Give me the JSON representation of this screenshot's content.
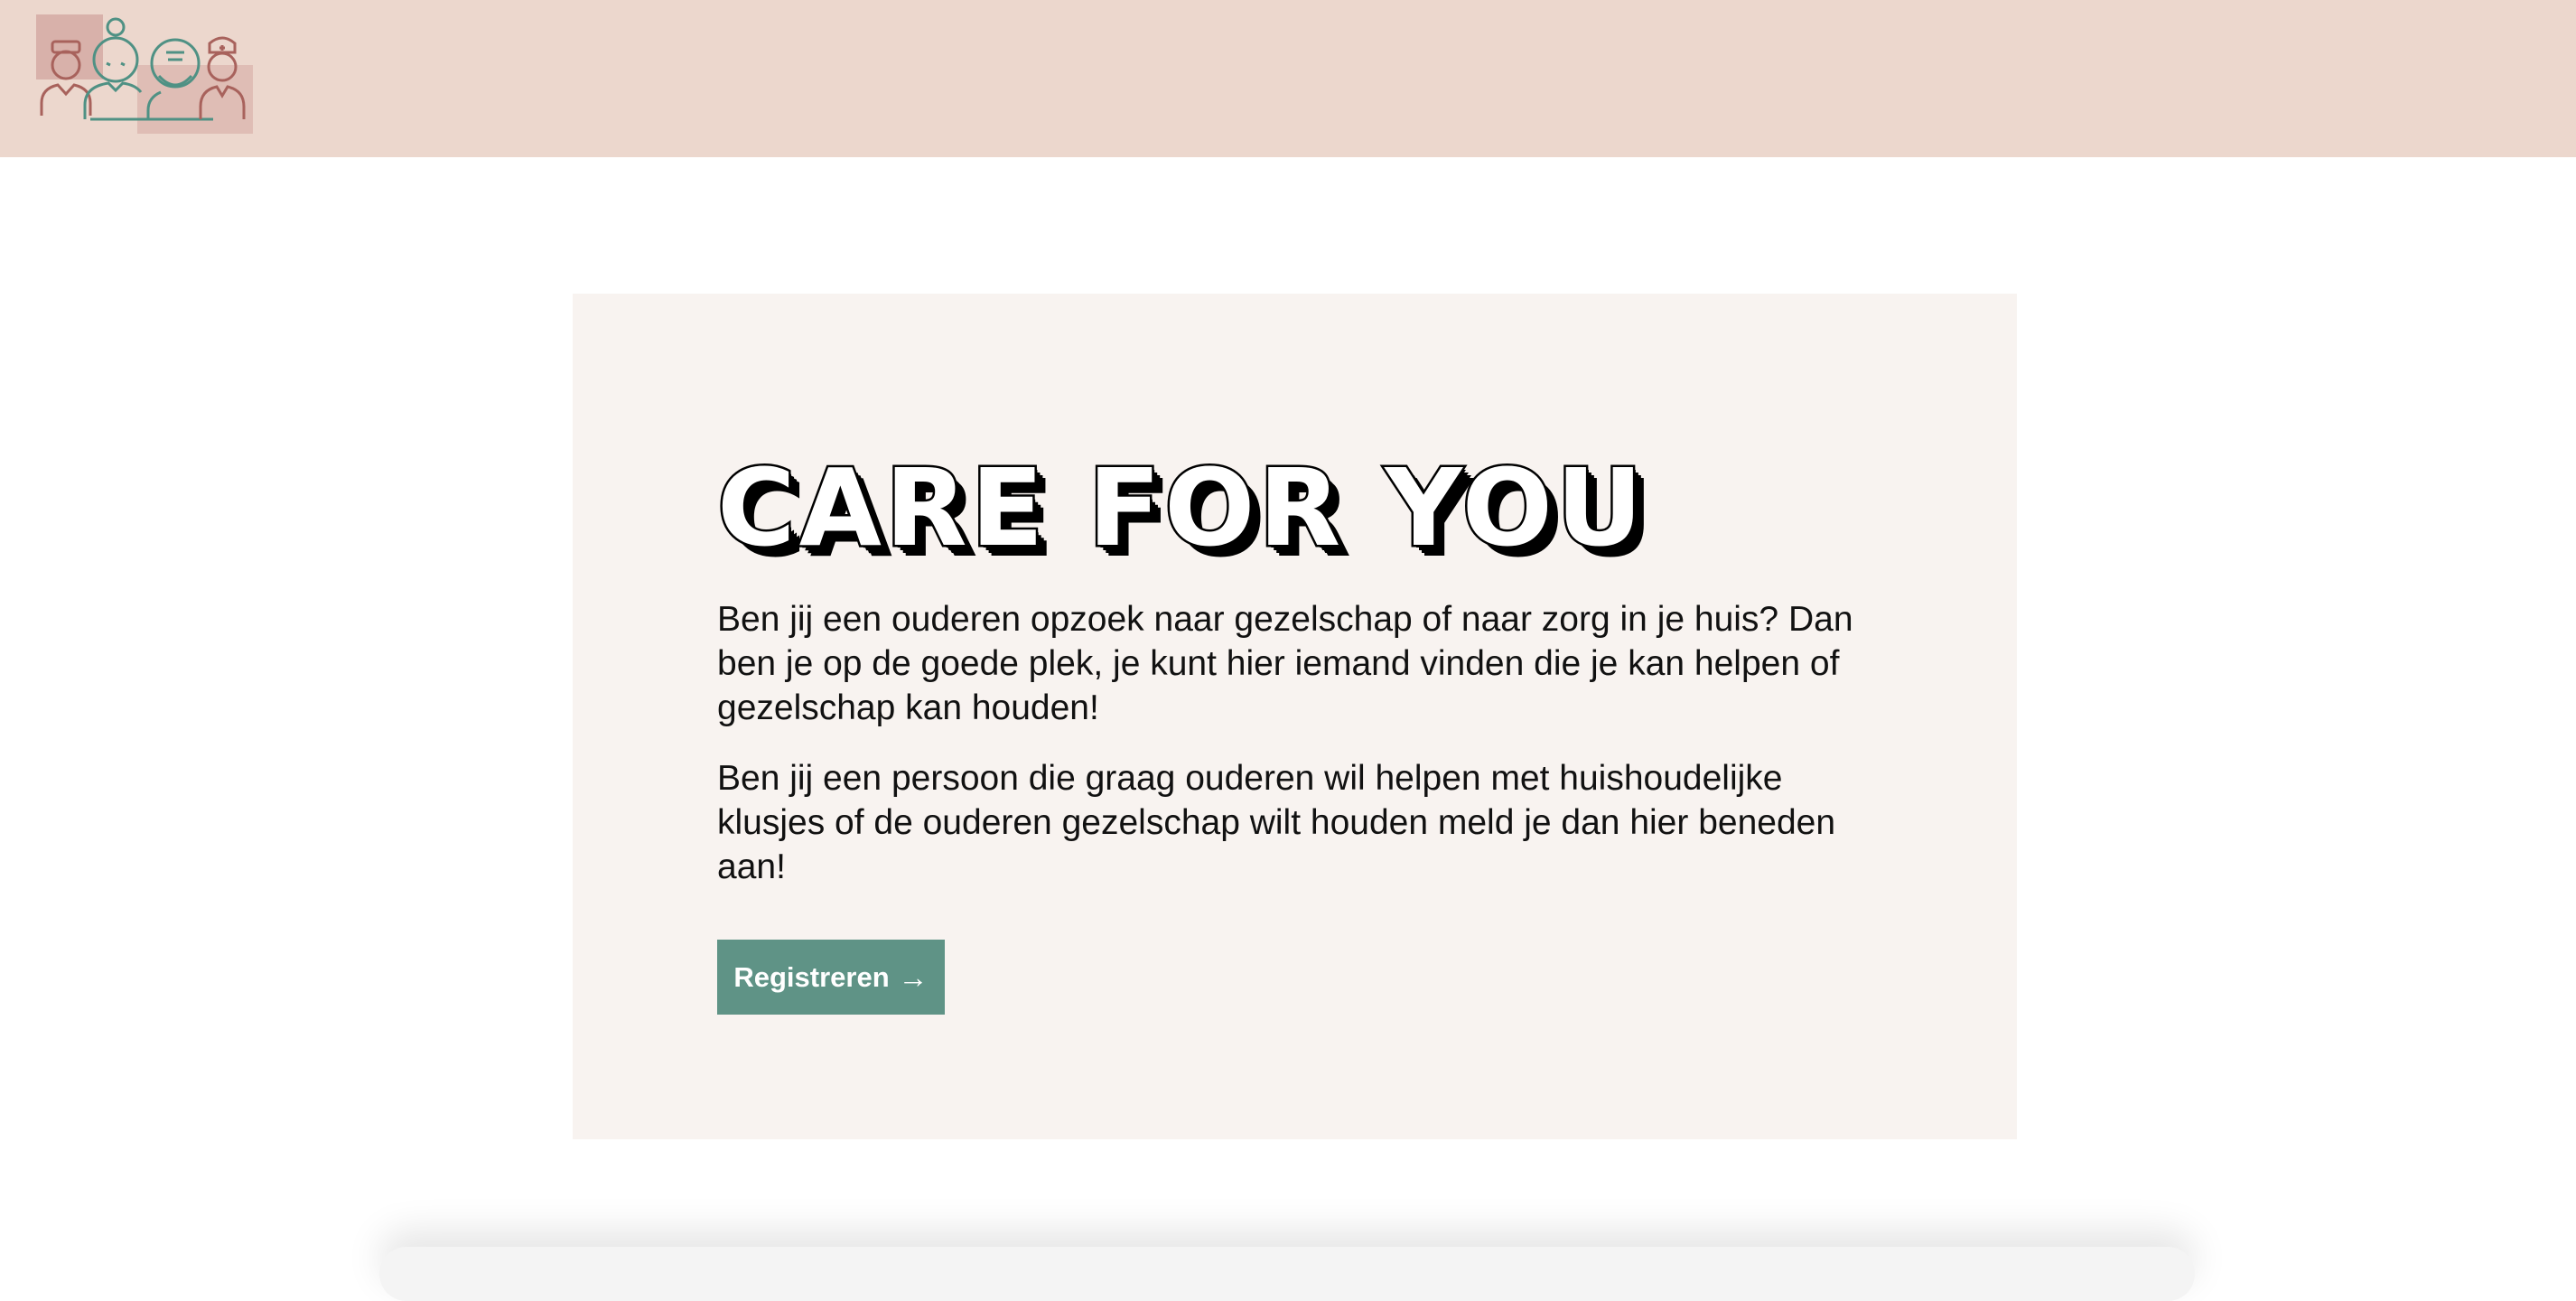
{
  "header": {
    "logo_icon": "elderly-care-people-logo-icon"
  },
  "hero": {
    "title": "CARE FOR YOU",
    "paragraph_1": "Ben jij een ouderen opzoek naar gezelschap of naar zorg in je huis? Dan ben je op de goede plek, je kunt hier iemand vinden die je kan helpen of gezelschap kan houden!",
    "paragraph_2": "Ben jij een persoon die graag ouderen wil helpen met huishoudelijke klusjes of de ouderen gezelschap wilt houden meld je dan hier beneden aan!",
    "button_label": "Registreren",
    "button_icon": "arrow-right-icon",
    "arrow_glyph": "→"
  },
  "colors": {
    "header_bg": "#ecd7cd",
    "hero_bg": "#f8f3f0",
    "button_bg": "#5f9386",
    "logo_red": "#a8625c",
    "logo_green": "#4f9184"
  }
}
